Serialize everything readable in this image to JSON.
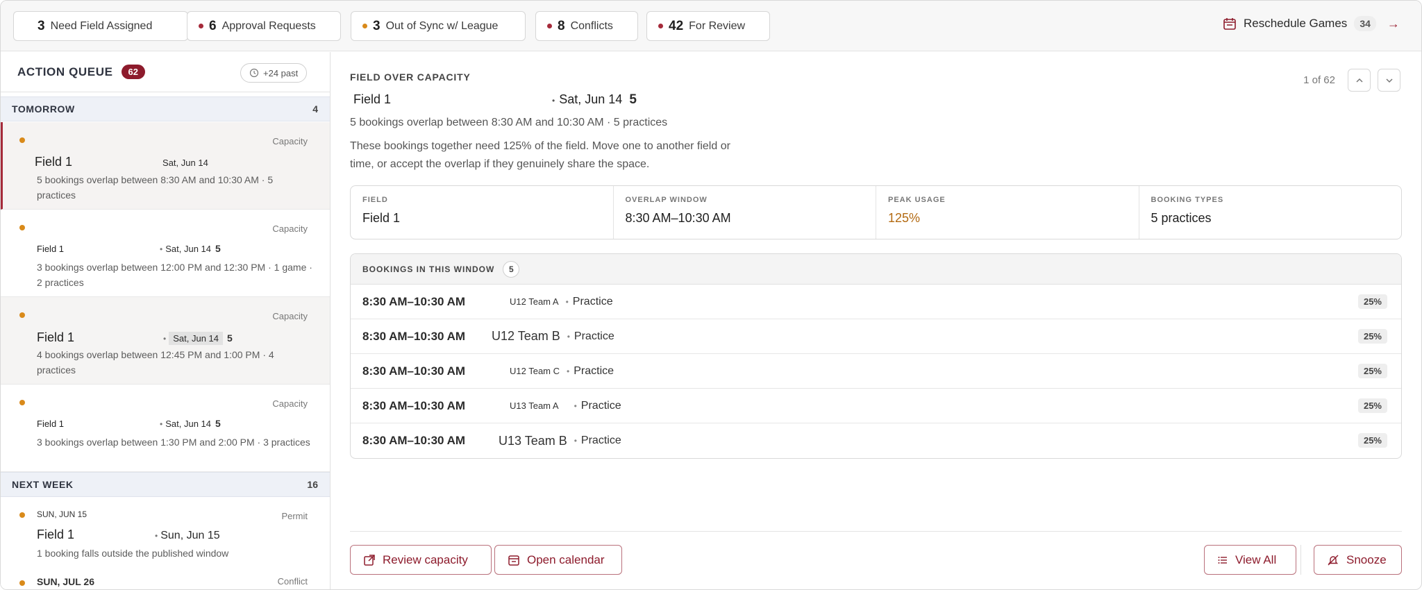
{
  "topbar": {
    "chips": [
      {
        "count": "3",
        "label": "Need Field Assigned",
        "dot": ""
      },
      {
        "count": "6",
        "label": "Approval Requests",
        "dot": "#a52a3a"
      },
      {
        "count": "3",
        "label": "Out of Sync w/ League",
        "dot": "#d98a1a"
      },
      {
        "count": "8",
        "label": "Conflicts",
        "dot": "#a52a3a"
      },
      {
        "count": "42",
        "label": "For Review",
        "dot": "#a52a3a"
      }
    ],
    "reschedule": {
      "label": "Reschedule Games",
      "count": "34",
      "arrow": "→"
    }
  },
  "queue": {
    "title": "ACTION QUEUE",
    "count": "62",
    "past_label": "+24 past",
    "groups": [
      {
        "title": "TOMORROW",
        "count": "4"
      },
      {
        "title": "NEXT WEEK",
        "count": "16"
      }
    ],
    "items": [
      {
        "type": "Capacity",
        "field": "Field 1",
        "date": "Sat, Jun 14",
        "extra": "",
        "desc": "5 bookings overlap between 8:30 AM and 10:30 AM · 5 practices"
      },
      {
        "type": "Capacity",
        "field": "Field 1",
        "date": "Sat, Jun 14",
        "extra": "5",
        "desc": "3 bookings overlap between 12:00 PM and 12:30 PM · 1 game · 2 practices"
      },
      {
        "type": "Capacity",
        "field": "Field 1",
        "date": "Sat, Jun 14",
        "extra": "5",
        "desc": "4 bookings overlap between 12:45 PM and 1:00 PM · 4 practices"
      },
      {
        "type": "Capacity",
        "field": "Field 1",
        "date": "Sat, Jun 14",
        "extra": "5",
        "desc": "3 bookings overlap between 1:30 PM and 2:00 PM · 3 practices"
      },
      {
        "type": "Permit",
        "eyebrow": "SUN, JUN 15",
        "field": "Field 1",
        "date": "Sun, Jun 15",
        "extra": "",
        "desc": "1 booking falls outside the published window"
      },
      {
        "type": "Conflict",
        "eyebrow": "SUN, JUL 26",
        "field": "",
        "date": "",
        "extra": "",
        "desc": ""
      }
    ]
  },
  "detail": {
    "eyebrow": "FIELD OVER CAPACITY",
    "field": "Field 1",
    "date": "Sat, Jun 14",
    "extra": "5",
    "sub": "5 bookings overlap between 8:30 AM and 10:30 AM · 5 practices",
    "text": "These bookings together need 125% of the field. Move one to another field or time, or accept the overlap if they genuinely share the space.",
    "pager": "1 of 62",
    "stats": [
      {
        "k": "FIELD",
        "v": "Field 1"
      },
      {
        "k": "OVERLAP WINDOW",
        "v": "8:30 AM–10:30 AM"
      },
      {
        "k": "PEAK USAGE",
        "v": "125%"
      },
      {
        "k": "BOOKING TYPES",
        "v": "5 practices"
      }
    ],
    "bookings_title": "BOOKINGS IN THIS WINDOW",
    "bookings_count": "5",
    "bookings": [
      {
        "time": "8:30 AM–10:30 AM",
        "team": "U12 Team A",
        "kind": "Practice",
        "pct": "25%"
      },
      {
        "time": "8:30 AM–10:30 AM",
        "team": "U12 Team B",
        "kind": "Practice",
        "pct": "25%"
      },
      {
        "time": "8:30 AM–10:30 AM",
        "team": "U12 Team C",
        "kind": "Practice",
        "pct": "25%"
      },
      {
        "time": "8:30 AM–10:30 AM",
        "team": "U13 Team A",
        "kind": "Practice",
        "pct": "25%"
      },
      {
        "time": "8:30 AM–10:30 AM",
        "team": "U13 Team B",
        "kind": "Practice",
        "pct": "25%"
      }
    ],
    "actions": {
      "review": "Review capacity",
      "calendar": "Open calendar",
      "view_all": "View All",
      "snooze": "Snooze"
    }
  }
}
